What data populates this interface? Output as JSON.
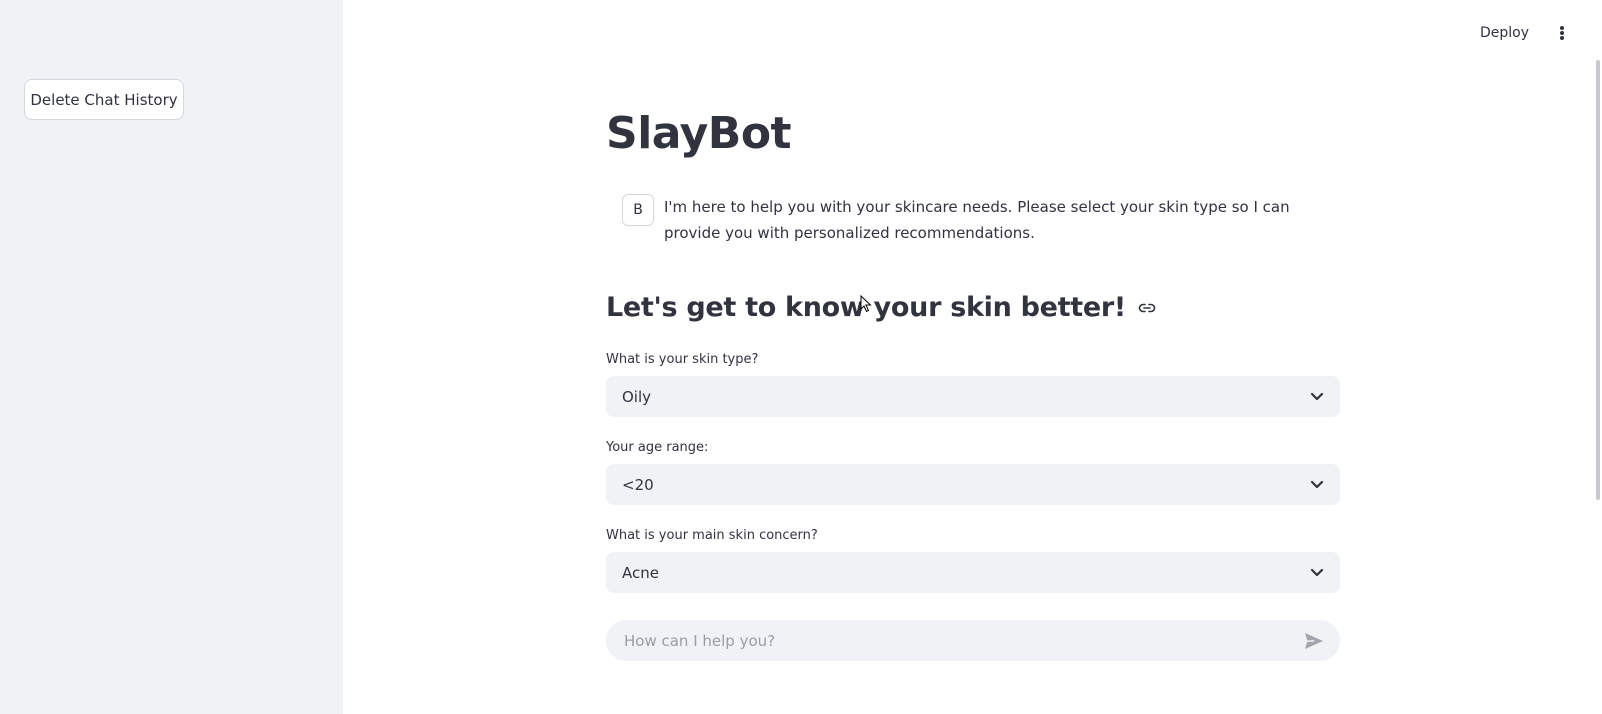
{
  "sidebar": {
    "delete_button_label": "Delete Chat History"
  },
  "header": {
    "deploy_label": "Deploy",
    "menu_icon": "more-vertical-icon"
  },
  "main": {
    "title": "SlayBot",
    "assistant_message": {
      "avatar_letter": "B",
      "text": "I'm here to help you with your skincare needs. Please select your skin type so I can provide you with personalized recommendations."
    },
    "section_heading": "Let's get to know your skin better!",
    "section_heading_icon": "link-icon",
    "fields": [
      {
        "label": "What is your skin type?",
        "value": "Oily"
      },
      {
        "label": "Your age range:",
        "value": "<20"
      },
      {
        "label": "What is your main skin concern?",
        "value": "Acne"
      }
    ],
    "chat_input": {
      "placeholder": "How can I help you?",
      "send_icon": "send-icon"
    }
  },
  "colors": {
    "sidebar_bg": "#f0f2f6",
    "input_bg": "#f0f2f6",
    "text": "#31333f",
    "placeholder": "#9a9ca6"
  }
}
